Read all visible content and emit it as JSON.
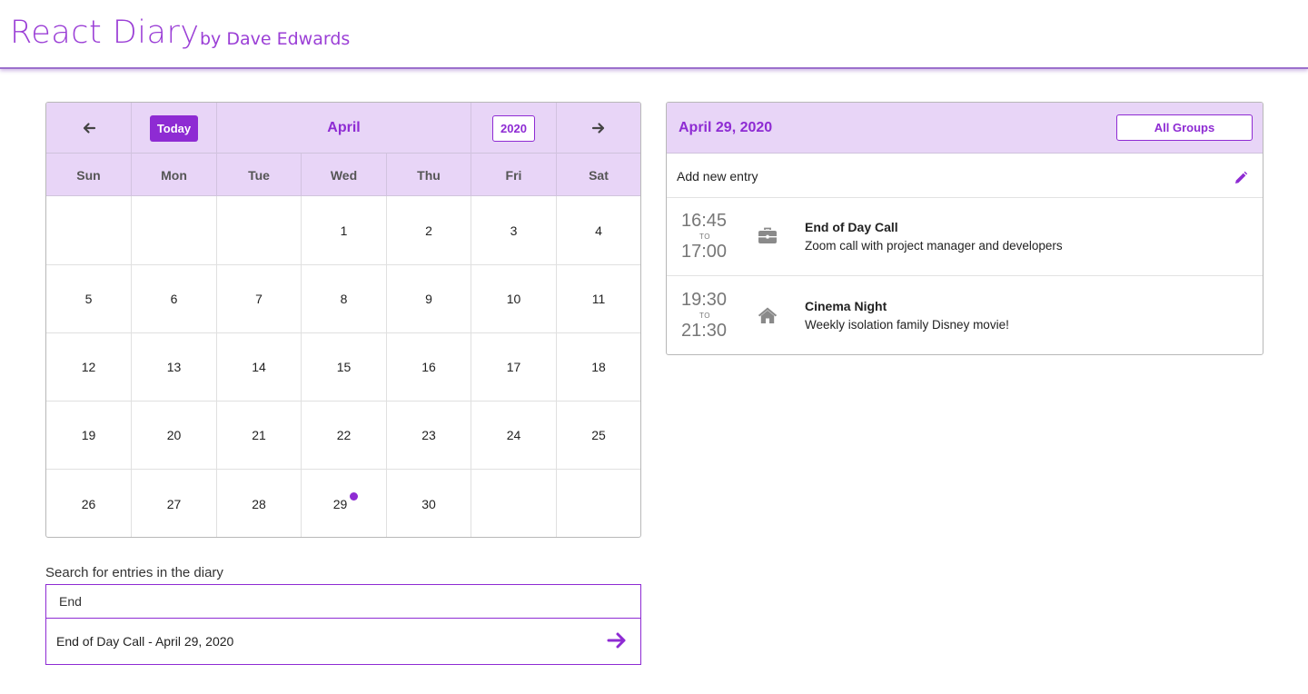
{
  "header": {
    "title": "React Diary",
    "author": "by Dave Edwards"
  },
  "colors": {
    "accent": "#8e2bd3",
    "header_bg": "#e8d5f7"
  },
  "calendar": {
    "prev_icon": "arrow-left-icon",
    "today_label": "Today",
    "month": "April",
    "year": "2020",
    "next_icon": "arrow-right-icon",
    "weekdays": [
      "Sun",
      "Mon",
      "Tue",
      "Wed",
      "Thu",
      "Fri",
      "Sat"
    ],
    "weeks": [
      [
        "",
        "",
        "",
        "1",
        "2",
        "3",
        "4"
      ],
      [
        "5",
        "6",
        "7",
        "8",
        "9",
        "10",
        "11"
      ],
      [
        "12",
        "13",
        "14",
        "15",
        "16",
        "17",
        "18"
      ],
      [
        "19",
        "20",
        "21",
        "22",
        "23",
        "24",
        "25"
      ],
      [
        "26",
        "27",
        "28",
        "29",
        "30",
        "",
        ""
      ]
    ],
    "days_with_entries": [
      "29"
    ]
  },
  "search": {
    "label": "Search for entries in the diary",
    "value": "End",
    "results": [
      {
        "text": "End of Day Call - April 29, 2020",
        "icon": "arrow-right-icon"
      }
    ]
  },
  "day_panel": {
    "date": "April 29, 2020",
    "groups_button": "All Groups",
    "add_entry_label": "Add new entry",
    "add_icon": "pencil-icon",
    "entries": [
      {
        "start": "16:45",
        "to": "TO",
        "end": "17:00",
        "icon": "briefcase-icon",
        "title": "End of Day Call",
        "description": "Zoom call with project manager and developers"
      },
      {
        "start": "19:30",
        "to": "TO",
        "end": "21:30",
        "icon": "home-icon",
        "title": "Cinema Night",
        "description": "Weekly isolation family Disney movie!"
      }
    ]
  }
}
